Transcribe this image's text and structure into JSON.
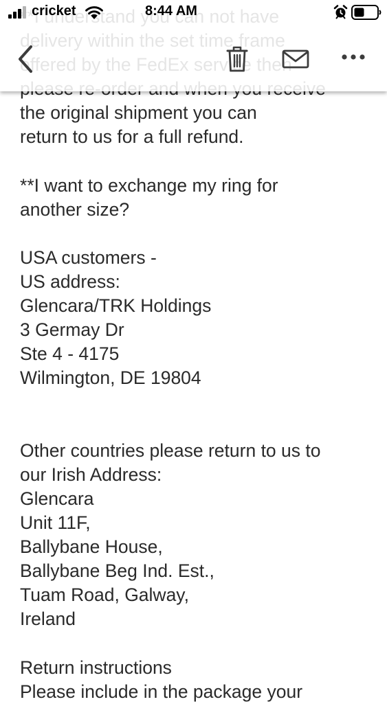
{
  "status_bar": {
    "carrier": "cricket",
    "time": "8:44 AM",
    "icons": [
      "signal-icon",
      "wifi-icon",
      "alarm-icon",
      "battery-icon"
    ]
  },
  "toolbar": {
    "icons": [
      "chevron-left-icon",
      "trash-icon",
      "envelope-icon",
      "more-icon"
    ]
  },
  "email": {
    "background_lines": [
      "**I understand you can not have",
      "delivery within the set time frame",
      "offered by the FedEx service then",
      "please re-order and when you receive"
    ],
    "lines": [
      "the original shipment you can",
      "return to us for a full refund.",
      "",
      "**I want to exchange my ring for",
      "another size?",
      "",
      "USA customers -",
      "US address:",
      "Glencara/TRK Holdings",
      "3 Germay Dr",
      "Ste 4 - 4175",
      "Wilmington, DE 19804",
      "",
      "",
      "Other countries please return to us to",
      "our Irish Address:",
      "Glencara",
      "Unit 11F,",
      "Ballybane House,",
      "Ballybane Beg Ind. Est.,",
      "Tuam Road, Galway,",
      "Ireland",
      "",
      "Return instructions",
      "Please include in the package your"
    ]
  },
  "colors": {
    "text": "#2a2a2a",
    "icon": "#3c3c3c",
    "chrome_background": "#ffffff"
  }
}
